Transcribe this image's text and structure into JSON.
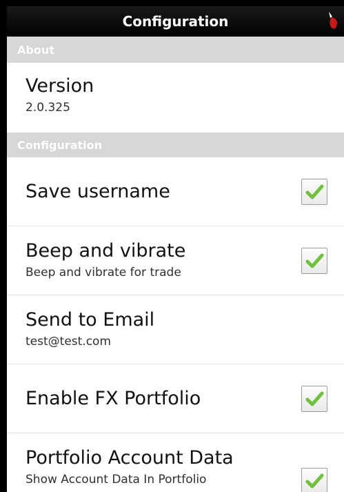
{
  "header": {
    "title": "Configuration"
  },
  "sections": {
    "about": {
      "label": "About",
      "version": {
        "title": "Version",
        "value": "2.0.325"
      }
    },
    "configuration": {
      "label": "Configuration",
      "save_username": {
        "title": "Save username",
        "checked": true
      },
      "beep_vibrate": {
        "title": "Beep and vibrate",
        "subtitle": "Beep and vibrate for trade",
        "checked": true
      },
      "send_email": {
        "title": "Send to Email",
        "subtitle": "test@test.com"
      },
      "enable_fx": {
        "title": "Enable FX Portfolio",
        "checked": true
      },
      "portfolio_account": {
        "title": "Portfolio Account Data",
        "subtitle": "Show Account Data In Portfolio",
        "checked": true
      }
    }
  },
  "colors": {
    "check": "#6fc13a",
    "section_bg": "#d7d7d7",
    "title_bar": "#000000"
  }
}
